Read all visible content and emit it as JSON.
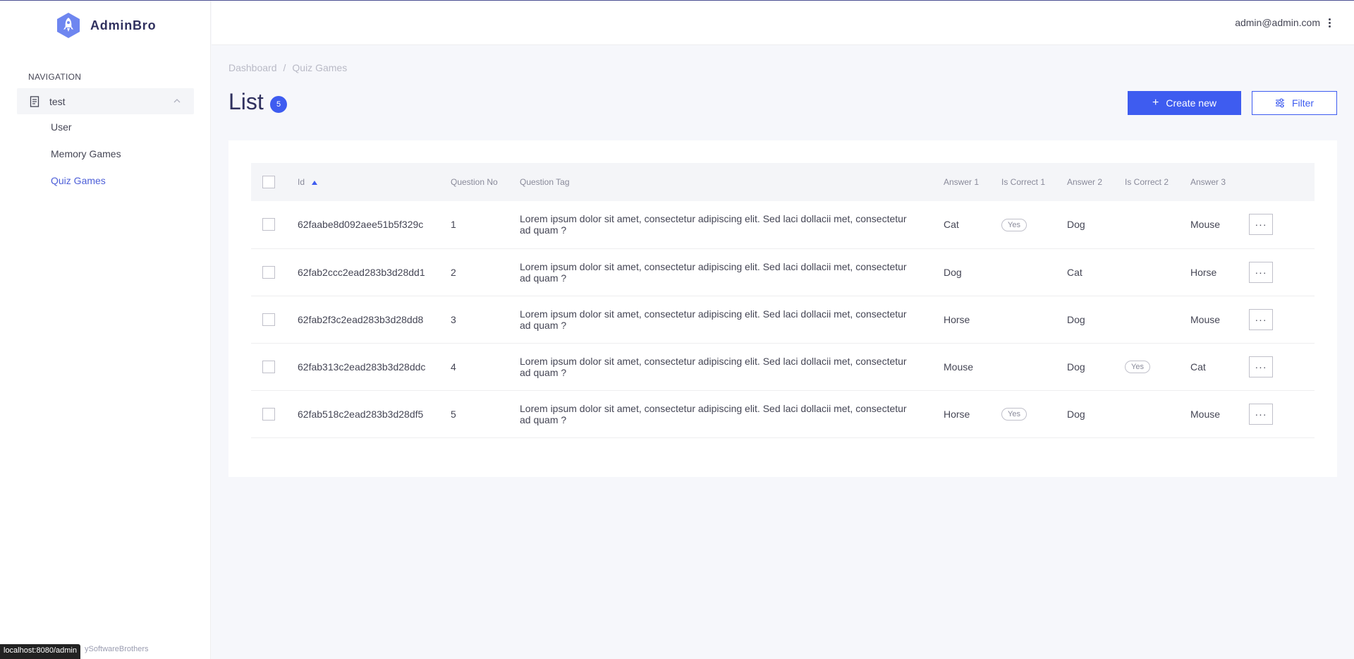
{
  "app": {
    "name": "AdminBro",
    "logo_icon": "rocket-icon"
  },
  "sidebar": {
    "heading": "NAVIGATION",
    "group": {
      "label": "test",
      "icon": "document-icon",
      "expanded": true
    },
    "items": [
      {
        "label": "User",
        "active": false
      },
      {
        "label": "Memory Games",
        "active": false
      },
      {
        "label": "Quiz Games",
        "active": true
      }
    ],
    "footer": "ySoftwareBrothers"
  },
  "status_bar": {
    "url": "localhost:8080/admin"
  },
  "header": {
    "user_email": "admin@admin.com"
  },
  "breadcrumb": [
    "Dashboard",
    "Quiz Games"
  ],
  "page": {
    "title": "List",
    "count": "5"
  },
  "actions": {
    "create_label": "Create new",
    "filter_label": "Filter"
  },
  "table": {
    "columns": [
      "Id",
      "Question No",
      "Question Tag",
      "Answer 1",
      "Is Correct 1",
      "Answer 2",
      "Is Correct 2",
      "Answer 3"
    ],
    "sorted_column": "Id",
    "rows": [
      {
        "id": "62faabe8d092aee51b5f329c",
        "qno": "1",
        "tag": "Lorem ipsum dolor sit amet, consectetur adipiscing elit. Sed laci dollacii met, consectetur ad quam ?",
        "a1": "Cat",
        "c1": "Yes",
        "a2": "Dog",
        "c2": "",
        "a3": "Mouse"
      },
      {
        "id": "62fab2ccc2ead283b3d28dd1",
        "qno": "2",
        "tag": "Lorem ipsum dolor sit amet, consectetur adipiscing elit. Sed laci dollacii met, consectetur ad quam ?",
        "a1": "Dog",
        "c1": "",
        "a2": "Cat",
        "c2": "",
        "a3": "Horse"
      },
      {
        "id": "62fab2f3c2ead283b3d28dd8",
        "qno": "3",
        "tag": "Lorem ipsum dolor sit amet, consectetur adipiscing elit. Sed laci dollacii met, consectetur ad quam ?",
        "a1": "Horse",
        "c1": "",
        "a2": "Dog",
        "c2": "",
        "a3": "Mouse"
      },
      {
        "id": "62fab313c2ead283b3d28ddc",
        "qno": "4",
        "tag": "Lorem ipsum dolor sit amet, consectetur adipiscing elit. Sed laci dollacii met, consectetur ad quam ?",
        "a1": "Mouse",
        "c1": "",
        "a2": "Dog",
        "c2": "Yes",
        "a3": "Cat"
      },
      {
        "id": "62fab518c2ead283b3d28df5",
        "qno": "5",
        "tag": "Lorem ipsum dolor sit amet, consectetur adipiscing elit. Sed laci dollacii met, consectetur ad quam ?",
        "a1": "Horse",
        "c1": "Yes",
        "a2": "Dog",
        "c2": "",
        "a3": "Mouse"
      }
    ]
  },
  "colors": {
    "accent": "#3e5cf0",
    "brand_dark": "#30315f",
    "active_nav": "#4d5fd8"
  }
}
